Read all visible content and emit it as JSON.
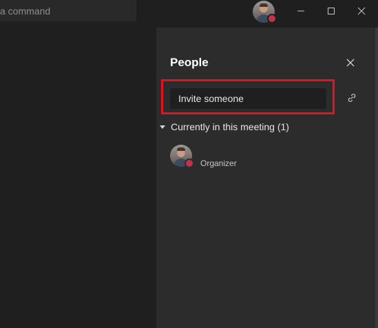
{
  "titlebar": {
    "command_placeholder": "a command",
    "user_status": "busy",
    "window_controls": {
      "minimize_icon": "minimize-icon",
      "maximize_icon": "maximize-icon",
      "close_icon": "close-icon"
    }
  },
  "panel": {
    "title": "People",
    "close_icon": "close-icon",
    "invite": {
      "placeholder": "Invite someone",
      "value": ""
    },
    "share_link_icon": "link-icon",
    "section": {
      "label": "Currently in this meeting (1)",
      "expanded": true,
      "participants": [
        {
          "name": "",
          "role": "Organizer",
          "status": "busy"
        }
      ]
    }
  },
  "colors": {
    "highlight": "#e81123",
    "presence_busy": "#c4314b",
    "panel_bg": "#2d2c2c",
    "app_bg": "#1f1f1f"
  }
}
